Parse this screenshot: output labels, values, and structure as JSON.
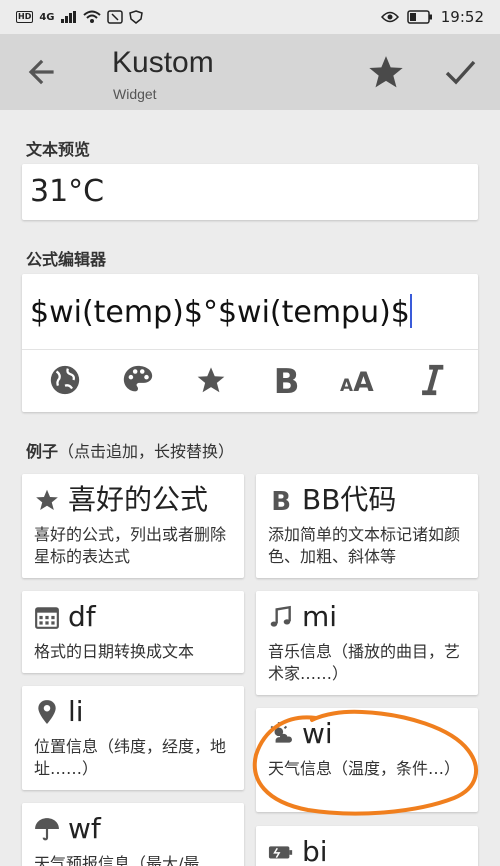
{
  "status_bar": {
    "left_text": "HD",
    "signal": "4G",
    "time": "19:52"
  },
  "app_bar": {
    "title": "Kustom",
    "subtitle": "Widget"
  },
  "preview": {
    "label": "文本预览",
    "value": "31°C"
  },
  "editor": {
    "label": "公式编辑器",
    "formula": "$wi(temp)$°$wi(tempu)$"
  },
  "examples": {
    "label": "例子",
    "hint": "（点击追加，长按替换）",
    "items": [
      {
        "icon": "star-icon",
        "title": "喜好的公式",
        "desc": "喜好的公式，列出或者删除星标的表达式"
      },
      {
        "icon": "bold-b-icon",
        "title": "BB代码",
        "desc": "添加简单的文本标记诸如颜色、加粗、斜体等"
      },
      {
        "icon": "calendar-icon",
        "title": "df",
        "desc": "格式的日期转换成文本"
      },
      {
        "icon": "music-note-icon",
        "title": "mi",
        "desc": "音乐信息（播放的曲目，艺术家……）"
      },
      {
        "icon": "location-pin-icon",
        "title": "li",
        "desc": "位置信息（纬度，经度，地址……）"
      },
      {
        "icon": "weather-icon",
        "title": "wi",
        "desc": "天气信息（温度，条件…）"
      },
      {
        "icon": "umbrella-icon",
        "title": "wf",
        "desc": "天气预报信息（最大/最"
      },
      {
        "icon": "battery-icon",
        "title": "bi",
        "desc": ""
      }
    ]
  },
  "annotation_color": "#f07f1e"
}
